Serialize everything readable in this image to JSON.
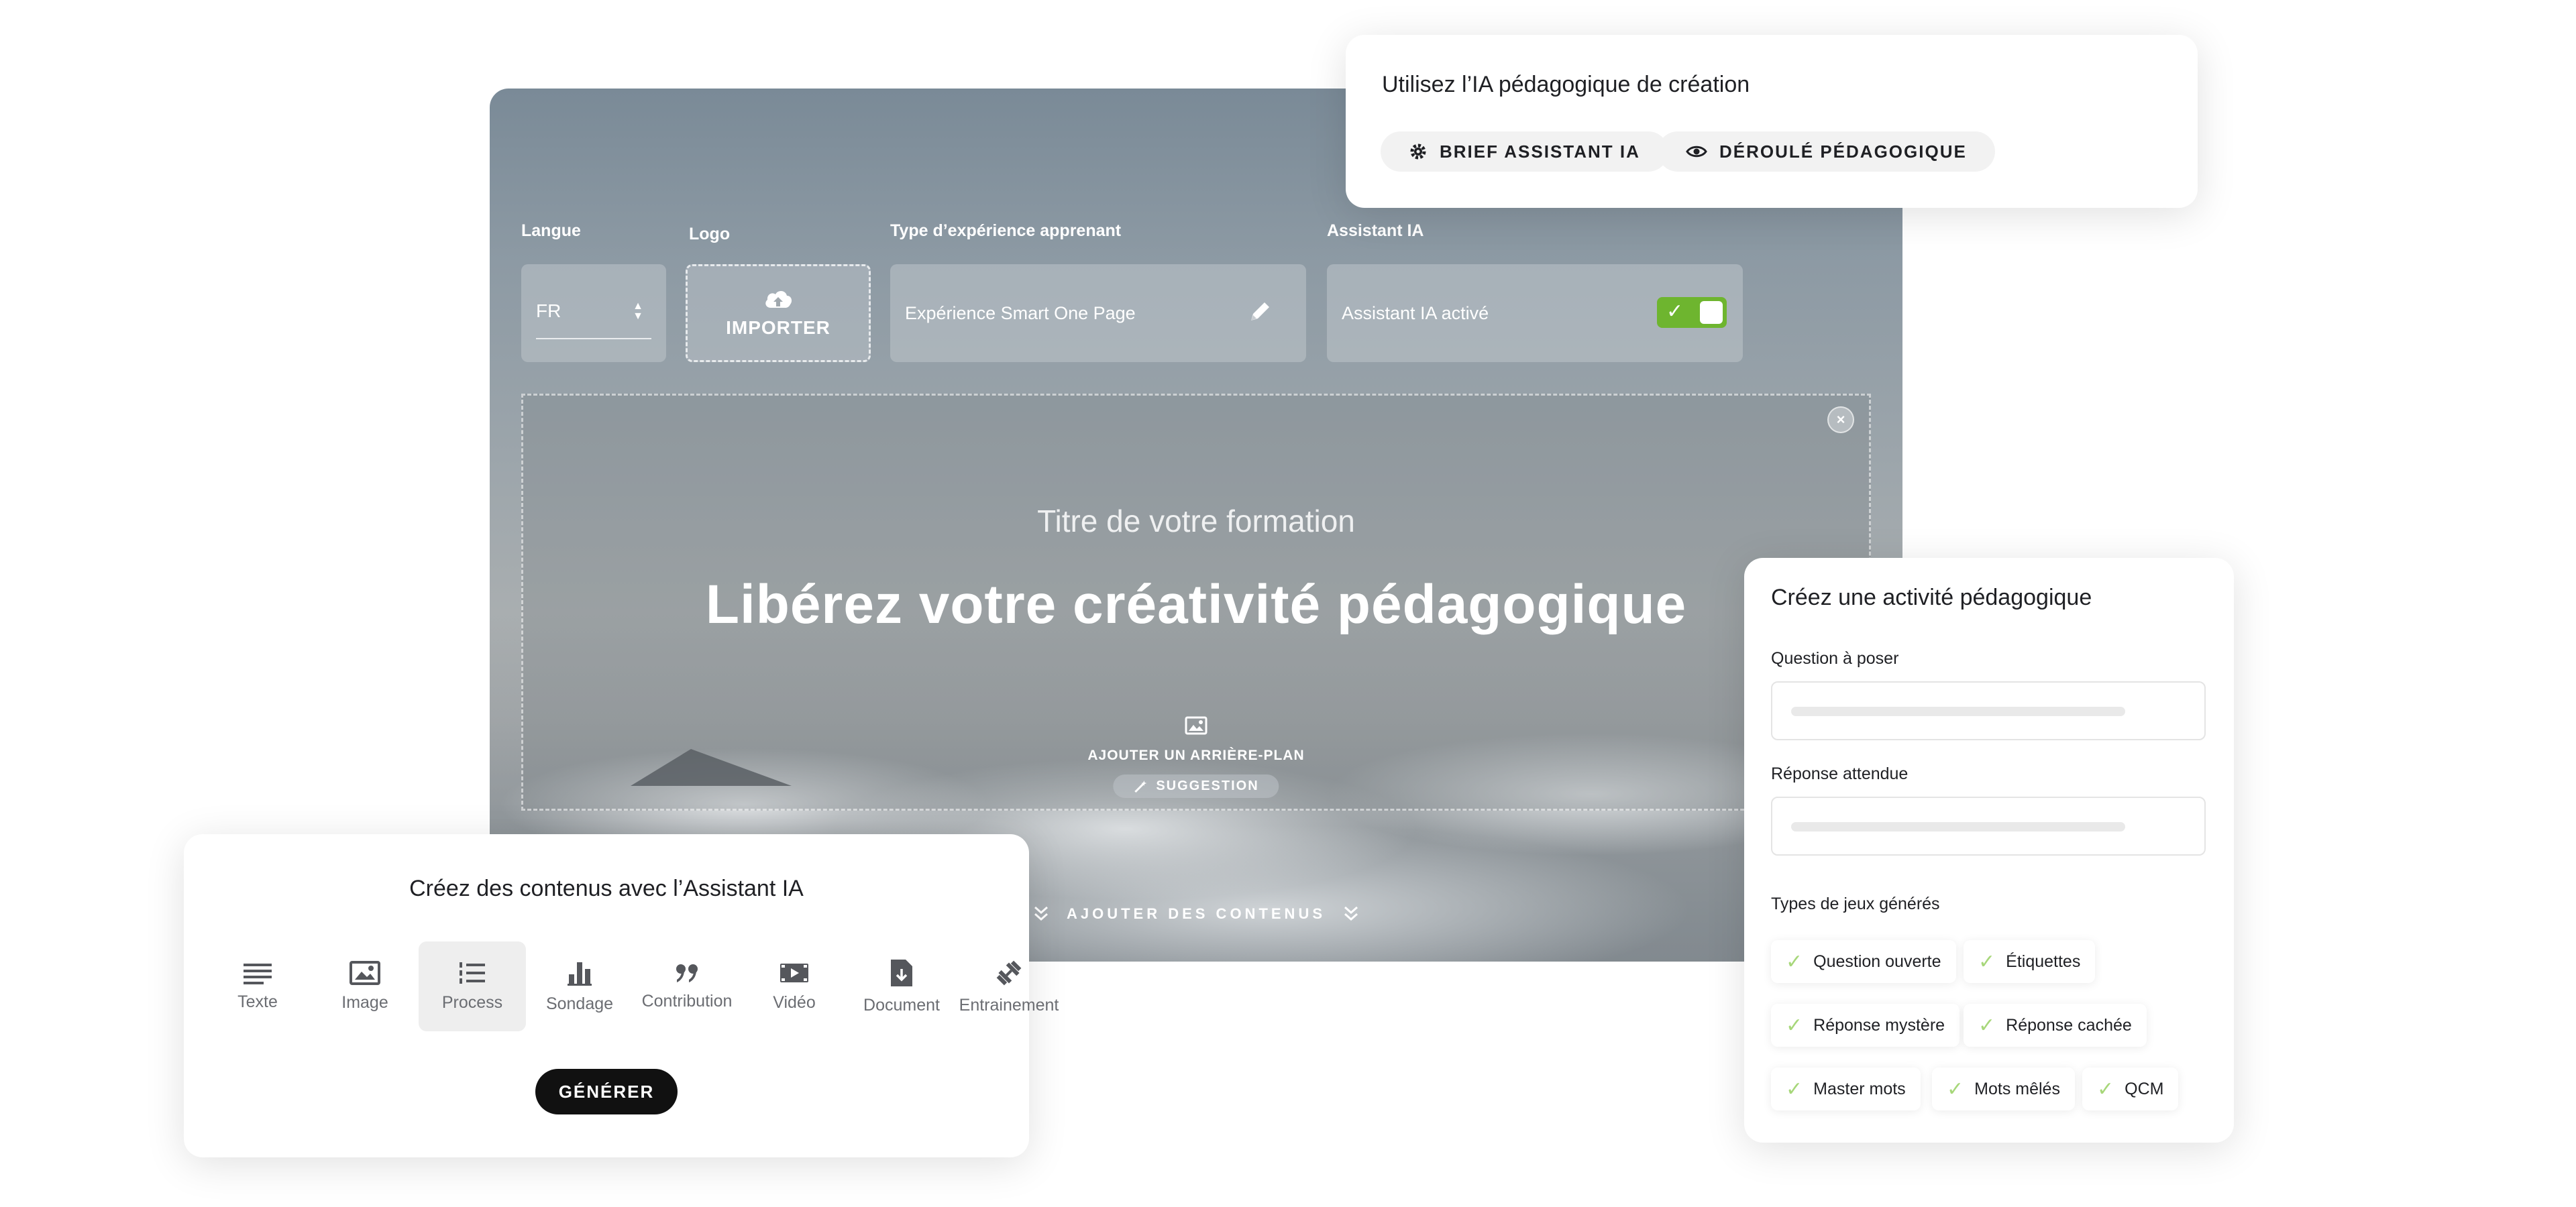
{
  "editor": {
    "fields": {
      "langue_label": "Langue",
      "langue_value": "FR",
      "logo_label": "Logo",
      "logo_button": "IMPORTER",
      "type_label": "Type d’expérience apprenant",
      "type_value": "Expérience Smart One Page",
      "assistant_label": "Assistant IA",
      "assistant_value": "Assistant IA activé",
      "assistant_enabled": true
    },
    "hero": {
      "subtitle": "Titre de votre formation",
      "title": "Libérez votre créativité pédagogique",
      "background_label": "AJOUTER UN ARRIÈRE-PLAN",
      "suggestion_label": "SUGGESTION"
    },
    "add_content_label": "AJOUTER DES CONTENUS"
  },
  "ia_card": {
    "title": "Utilisez l’IA pédagogique de création",
    "brief_button": "BRIEF ASSISTANT IA",
    "deroule_button": "DÉROULÉ PÉDAGOGIQUE"
  },
  "content_card": {
    "title": "Créez des contenus avec l’Assistant IA",
    "tools": [
      {
        "label": "Texte",
        "icon": "text-lines-icon"
      },
      {
        "label": "Image",
        "icon": "image-icon"
      },
      {
        "label": "Process",
        "icon": "numbered-list-icon",
        "active": true
      },
      {
        "label": "Sondage",
        "icon": "bar-chart-icon"
      },
      {
        "label": "Contribution",
        "icon": "quote-icon"
      },
      {
        "label": "Vidéo",
        "icon": "video-icon"
      },
      {
        "label": "Document",
        "icon": "document-download-icon"
      },
      {
        "label": "Entrainement",
        "icon": "dumbbell-icon"
      }
    ],
    "generate_button": "GÉNÉRER"
  },
  "activity_card": {
    "title": "Créez une activité pédagogique",
    "question_label": "Question à poser",
    "answer_label": "Réponse attendue",
    "games_label": "Types de jeux générés",
    "games": [
      "Question ouverte",
      "Étiquettes",
      "Réponse mystère",
      "Réponse cachée",
      "Master mots",
      "Mots mêlés",
      "QCM"
    ]
  },
  "colors": {
    "accent_green": "#6eb52f",
    "check_green": "#a7d77a",
    "button_dark": "#111111"
  }
}
